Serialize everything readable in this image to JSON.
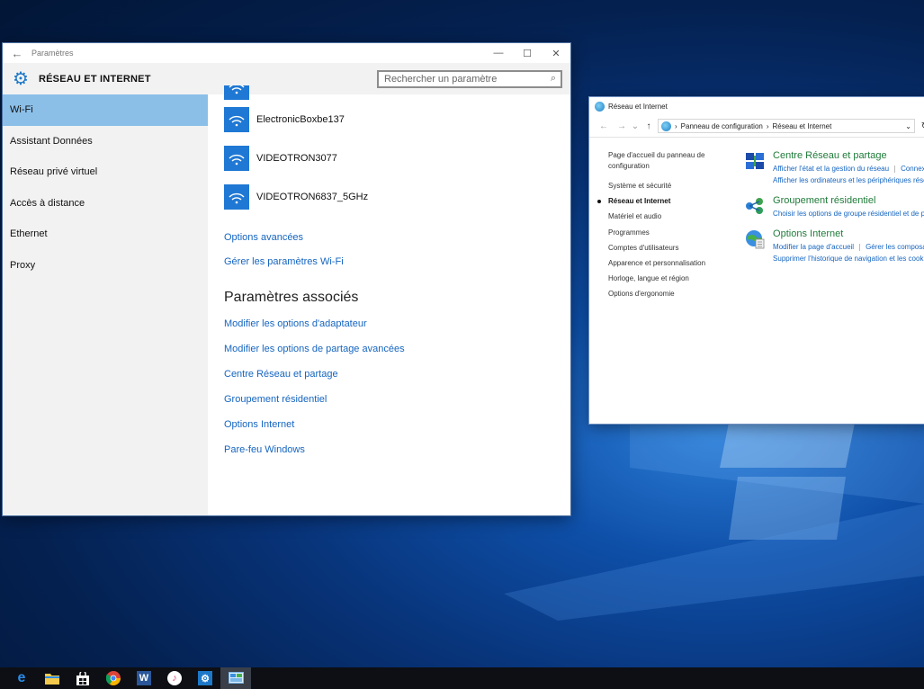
{
  "settings": {
    "window_title": "Paramètres",
    "header_title": "RÉSEAU ET INTERNET",
    "search_placeholder": "Rechercher un paramètre",
    "nav_items": [
      {
        "label": "Wi-Fi",
        "active": true
      },
      {
        "label": "Assistant Données"
      },
      {
        "label": "Réseau privé virtuel"
      },
      {
        "label": "Accès à distance"
      },
      {
        "label": "Ethernet"
      },
      {
        "label": "Proxy"
      }
    ],
    "networks": [
      "ElectronicBoxbe137",
      "VIDEOTRON3077",
      "VIDEOTRON6837_5GHz"
    ],
    "links": {
      "advanced": "Options avancées",
      "manage": "Gérer les paramètres Wi-Fi"
    },
    "associated_title": "Paramètres associés",
    "associated_links": [
      "Modifier les options d'adaptateur",
      "Modifier les options de partage avancées",
      "Centre Réseau et partage",
      "Groupement résidentiel",
      "Options Internet",
      "Pare-feu Windows"
    ]
  },
  "control_panel": {
    "window_title": "Réseau et Internet",
    "breadcrumb": [
      "Panneau de configuration",
      "Réseau et Internet"
    ],
    "left_items": [
      "Page d'accueil du panneau de configuration",
      "Système et sécurité",
      "Réseau et Internet",
      "Matériel et audio",
      "Programmes",
      "Comptes d'utilisateurs",
      "Apparence et personnalisation",
      "Horloge, langue et région",
      "Options d'ergonomie"
    ],
    "current_item": "Réseau et Internet",
    "sections": [
      {
        "title": "Centre Réseau et partage",
        "icon": "network-center-icon",
        "links": [
          "Afficher l'état et la gestion du réseau",
          "Connexi",
          "Afficher les ordinateurs et les périphériques résea"
        ]
      },
      {
        "title": "Groupement résidentiel",
        "icon": "homegroup-icon",
        "links": [
          "Choisir les options de groupe résidentiel et de pa"
        ]
      },
      {
        "title": "Options Internet",
        "icon": "internet-options-icon",
        "links": [
          "Modifier la page d'accueil",
          "Gérer les composa",
          "Supprimer l'historique de navigation et les cooki"
        ]
      }
    ]
  },
  "taskbar": {
    "items": [
      {
        "icon": "edge-icon",
        "glyph": "e",
        "color": "#2b8ce6"
      },
      {
        "icon": "file-explorer-icon",
        "glyph": "",
        "color": "#f2c94c"
      },
      {
        "icon": "store-icon",
        "glyph": "",
        "color": "#ffffff"
      },
      {
        "icon": "chrome-icon",
        "glyph": "",
        "color": "#db4437"
      },
      {
        "icon": "word-icon",
        "glyph": "W",
        "color": "#2b579a"
      },
      {
        "icon": "itunes-icon",
        "glyph": "♪",
        "color": "#ffffff"
      },
      {
        "icon": "settings-icon",
        "glyph": "⚙",
        "color": "#1e78c8"
      },
      {
        "icon": "control-panel-icon",
        "glyph": "",
        "color": "#7bb6e8",
        "active": true
      }
    ]
  }
}
